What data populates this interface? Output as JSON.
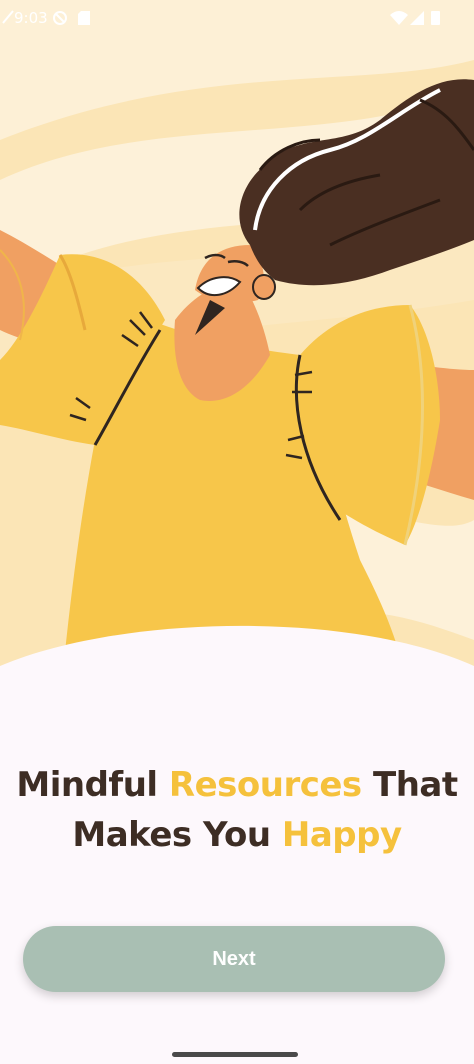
{
  "status_bar": {
    "time": "9:03",
    "icons": [
      "no-sim-icon",
      "do-not-disturb-icon",
      "sd-card-icon",
      "wifi-icon",
      "signal-icon",
      "battery-icon"
    ]
  },
  "onboarding": {
    "headline": {
      "line1_part1": "Mindful ",
      "line1_highlight": "Resources",
      "line1_part2": " That",
      "line2_part1": "Makes You ",
      "line2_highlight": "Happy"
    },
    "next_label": "Next"
  },
  "colors": {
    "background": "#fdf8fc",
    "highlight": "#f5c13c",
    "text_dark": "#3d2d24",
    "button": "#a9bfb3",
    "shirt": "#f7c64a",
    "skin": "#f0a062",
    "hair": "#4a2f22"
  }
}
